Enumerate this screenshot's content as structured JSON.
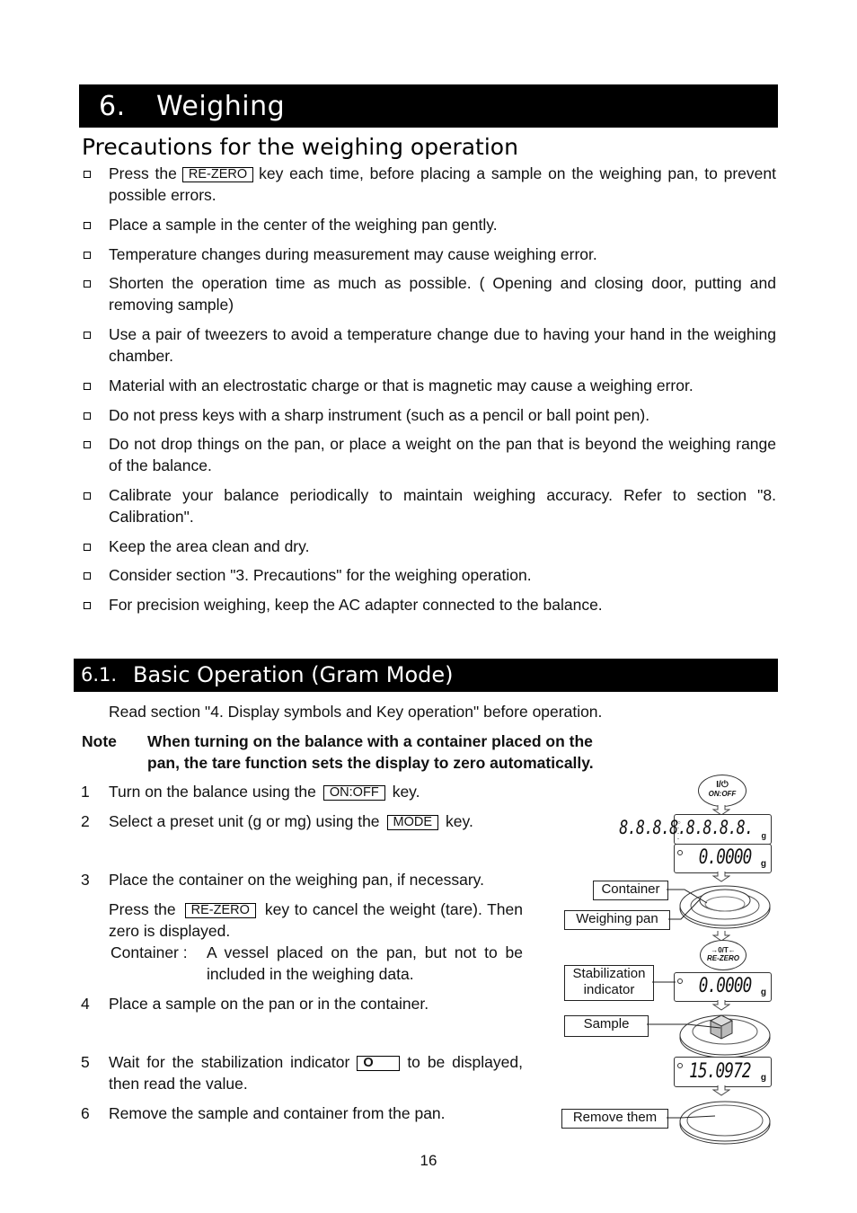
{
  "section": {
    "number": "6.",
    "title": "Weighing"
  },
  "precautions": {
    "heading": "Precautions for the weighing operation",
    "items": [
      {
        "before": "Press the",
        "key": "RE-ZERO",
        "after": "key each time, before placing a sample on the weighing pan, to prevent possible errors."
      },
      {
        "text": "Place a sample in the center of the weighing pan gently."
      },
      {
        "text": "Temperature changes during measurement may cause weighing error."
      },
      {
        "text": "Shorten the operation time as much as possible. ( Opening and closing door, putting and removing sample)"
      },
      {
        "text": "Use a pair of tweezers to avoid a temperature change due to having your hand in the weighing chamber."
      },
      {
        "text": "Material with an electrostatic charge or that is magnetic may cause a weighing error."
      },
      {
        "text": "Do not press keys with a sharp instrument (such as a pencil or ball point pen)."
      },
      {
        "text": "Do not drop things on the pan, or place a weight on the pan that is beyond the weighing range of the balance."
      },
      {
        "text": "Calibrate your balance periodically to maintain weighing accuracy. Refer to section \"8. Calibration\"."
      },
      {
        "text": "Keep the area clean and dry."
      },
      {
        "text": "Consider section \"3. Precautions\" for the weighing operation."
      },
      {
        "text": "For precision weighing, keep the AC adapter connected to the balance."
      }
    ]
  },
  "subsection": {
    "number": "6.1.",
    "title": "Basic Operation (Gram Mode)",
    "intro": "Read section \"4. Display symbols and Key operation\" before operation.",
    "note_label": "Note",
    "note_line1": "When turning on the balance with a container placed on the",
    "note_line2": "pan, the tare function sets the display to zero automatically.",
    "steps": [
      {
        "num": "1",
        "before": "Turn on the balance using the",
        "key": "ON:OFF",
        "after": "key."
      },
      {
        "num": "2",
        "before": "Select a preset unit (g or mg) using the",
        "key": "MODE",
        "after": "key."
      },
      {
        "num": "3",
        "text": "Place the container on the weighing pan, if necessary.",
        "sub_before": "Press the",
        "sub_key": "RE-ZERO",
        "sub_after": "key to cancel the weight (tare). Then zero is displayed.",
        "def_term": "Container :",
        "def_text": "A vessel placed on the pan, but not to be included in the weighing data."
      },
      {
        "num": "4",
        "text": "Place a sample on the pan or in the container."
      },
      {
        "num": "5",
        "before": "Wait for the stabilization indicator",
        "key": "O",
        "after": "to be displayed, then read the value."
      },
      {
        "num": "6",
        "text": "Remove the sample and container from the pan."
      }
    ]
  },
  "diagram": {
    "onoff_key_top": "I/⏻",
    "onoff_key_bottom": "ON:OFF",
    "display_all": "8.8.8.8.8.8.8.8.",
    "display_zero": "0.0000",
    "display_unit": "g",
    "rezero_key_top": "→0/T←",
    "rezero_key_bottom": "RE-ZERO",
    "display_sample": "15.0972",
    "labels": {
      "container": "Container",
      "weighing_pan": "Weighing pan",
      "stabilization_line1": "Stabilization",
      "stabilization_line2": "indicator",
      "sample": "Sample",
      "remove": "Remove them"
    }
  },
  "page_number": "16"
}
